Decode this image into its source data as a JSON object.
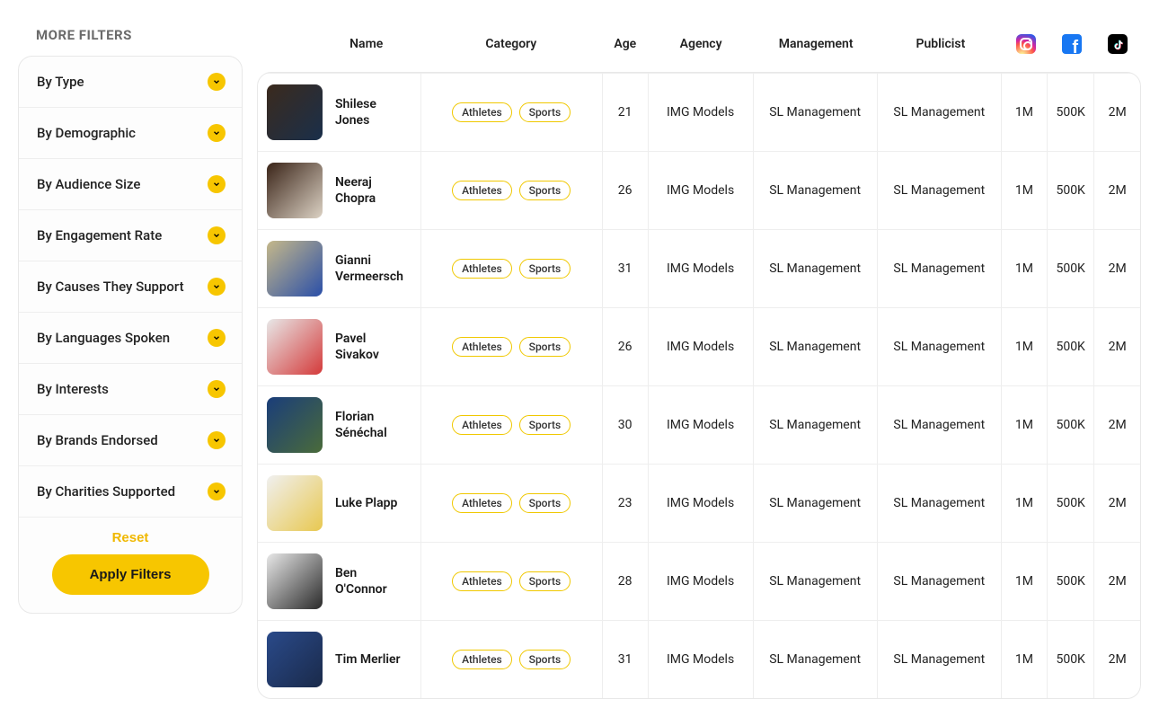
{
  "sidebar": {
    "title": "MORE FILTERS",
    "filters": [
      {
        "label": "By Type"
      },
      {
        "label": "By Demographic"
      },
      {
        "label": "By Audience Size"
      },
      {
        "label": "By Engagement Rate"
      },
      {
        "label": "By Causes They Support"
      },
      {
        "label": "By Languages Spoken"
      },
      {
        "label": "By Interests"
      },
      {
        "label": "By Brands Endorsed"
      },
      {
        "label": "By Charities Supported"
      }
    ],
    "reset_label": "Reset",
    "apply_label": "Apply Filters"
  },
  "table": {
    "headers": {
      "name": "Name",
      "category": "Category",
      "age": "Age",
      "agency": "Agency",
      "management": "Management",
      "publicist": "Publicist"
    },
    "social_icons": [
      "instagram",
      "facebook",
      "tiktok"
    ],
    "rows": [
      {
        "name": "Shilese Jones",
        "avatar_colors": [
          "#3b2a1d",
          "#1a2f4a"
        ],
        "categories": [
          "Athletes",
          "Sports"
        ],
        "age": "21",
        "agency": "IMG Models",
        "management": "SL  Management",
        "publicist": "SL  Management",
        "instagram": "1M",
        "facebook": "500K",
        "tiktok": "2M"
      },
      {
        "name": "Neeraj Chopra",
        "avatar_colors": [
          "#3a2418",
          "#dcd2c4"
        ],
        "categories": [
          "Athletes",
          "Sports"
        ],
        "age": "26",
        "agency": "IMG Models",
        "management": "SL  Management",
        "publicist": "SL  Management",
        "instagram": "1M",
        "facebook": "500K",
        "tiktok": "2M"
      },
      {
        "name": "Gianni Vermeersch",
        "avatar_colors": [
          "#c5b88a",
          "#2a4fa8"
        ],
        "categories": [
          "Athletes",
          "Sports"
        ],
        "age": "31",
        "agency": "IMG Models",
        "management": "SL  Management",
        "publicist": "SL  Management",
        "instagram": "1M",
        "facebook": "500K",
        "tiktok": "2M"
      },
      {
        "name": "Pavel Sivakov",
        "avatar_colors": [
          "#e8e8e8",
          "#d43a3a"
        ],
        "categories": [
          "Athletes",
          "Sports"
        ],
        "age": "26",
        "agency": "IMG Models",
        "management": "SL  Management",
        "publicist": "SL  Management",
        "instagram": "1M",
        "facebook": "500K",
        "tiktok": "2M"
      },
      {
        "name": "Florian Sénéchal",
        "avatar_colors": [
          "#1a3d7a",
          "#4a6b3a"
        ],
        "categories": [
          "Athletes",
          "Sports"
        ],
        "age": "30",
        "agency": "IMG Models",
        "management": "SL  Management",
        "publicist": "SL  Management",
        "instagram": "1M",
        "facebook": "500K",
        "tiktok": "2M"
      },
      {
        "name": "Luke Plapp",
        "avatar_colors": [
          "#f0f0f0",
          "#e8c850"
        ],
        "categories": [
          "Athletes",
          "Sports"
        ],
        "age": "23",
        "agency": "IMG Models",
        "management": "SL  Management",
        "publicist": "SL  Management",
        "instagram": "1M",
        "facebook": "500K",
        "tiktok": "2M"
      },
      {
        "name": "Ben O'Connor",
        "avatar_colors": [
          "#e8e8e8",
          "#2a2a2a"
        ],
        "categories": [
          "Athletes",
          "Sports"
        ],
        "age": "28",
        "agency": "IMG Models",
        "management": "SL  Management",
        "publicist": "SL  Management",
        "instagram": "1M",
        "facebook": "500K",
        "tiktok": "2M"
      },
      {
        "name": "Tim Merlier",
        "avatar_colors": [
          "#2a4a8a",
          "#1a2a4a"
        ],
        "categories": [
          "Athletes",
          "Sports"
        ],
        "age": "31",
        "agency": "IMG Models",
        "management": "SL  Management",
        "publicist": "SL  Management",
        "instagram": "1M",
        "facebook": "500K",
        "tiktok": "2M"
      }
    ]
  }
}
